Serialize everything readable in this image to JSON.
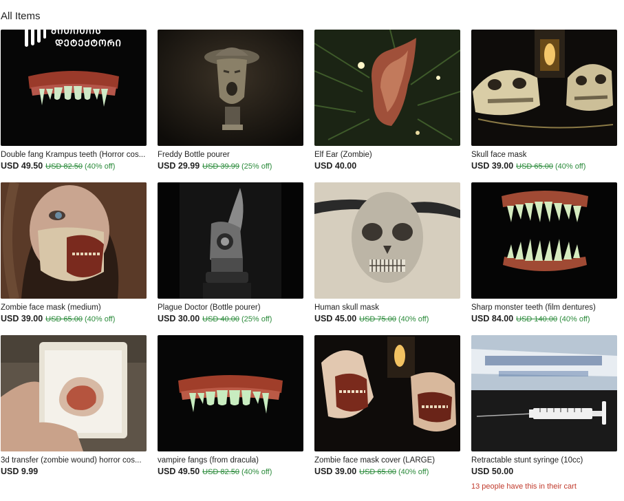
{
  "heading": "All Items",
  "logo": {
    "line1": "ᲛᲘᲗᲘᲗᲘᲡ",
    "line2": "ᲓᲔᲢᲔᲥᲢᲝᲠᲘ",
    "color": "#ffffff"
  },
  "colors": {
    "discount": "#2a8a3a",
    "cart_note": "#c0392b",
    "text": "#222222"
  },
  "items": [
    {
      "title": "Double fang Krampus teeth (Horror cos...",
      "price": "USD 49.50",
      "original": "USD 82.50",
      "discount": "(40% off)",
      "image": "fang-teeth"
    },
    {
      "title": "Freddy Bottle pourer",
      "price": "USD 29.99",
      "original": "USD 39.99",
      "discount": "(25% off)",
      "image": "freddy-pourer"
    },
    {
      "title": "Elf Ear (Zombie)",
      "price": "USD 40.00",
      "original": "",
      "discount": "",
      "image": "elf-ear"
    },
    {
      "title": "Skull face mask",
      "price": "USD 39.00",
      "original": "USD 65.00",
      "discount": "(40% off)",
      "image": "skull-masks"
    },
    {
      "title": "Zombie face mask (medium)",
      "price": "USD 39.00",
      "original": "USD 65.00",
      "discount": "(40% off)",
      "image": "zombie-woman"
    },
    {
      "title": "Plague Doctor (Bottle pourer)",
      "price": "USD 30.00",
      "original": "USD 40.00",
      "discount": "(25% off)",
      "image": "plague-doctor"
    },
    {
      "title": "Human skull mask",
      "price": "USD 45.00",
      "original": "USD 75.00",
      "discount": "(40% off)",
      "image": "human-skull"
    },
    {
      "title": "Sharp monster teeth (film dentures)",
      "price": "USD 84.00",
      "original": "USD 140.00",
      "discount": "(40% off)",
      "image": "monster-teeth"
    },
    {
      "title": "3d transfer (zombie wound) horror cos...",
      "price": "USD 9.99",
      "original": "",
      "discount": "",
      "image": "zombie-wound"
    },
    {
      "title": "vampire fangs (from dracula)",
      "price": "USD 49.50",
      "original": "USD 82.50",
      "discount": "(40% off)",
      "image": "vampire-fangs"
    },
    {
      "title": "Zombie face mask cover (LARGE)",
      "price": "USD 39.00",
      "original": "USD 65.00",
      "discount": "(40% off)",
      "image": "zombie-mask-cover"
    },
    {
      "title": "Retractable stunt syringe (10cc)",
      "price": "USD 50.00",
      "original": "",
      "discount": "",
      "image": "syringe",
      "cart_note": "13 people have this in their cart"
    }
  ]
}
